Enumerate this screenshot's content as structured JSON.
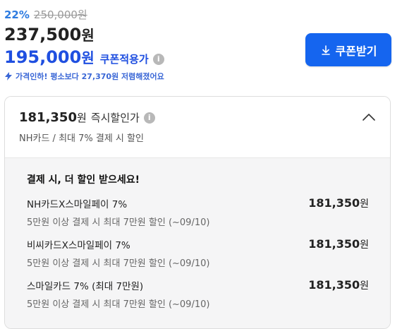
{
  "pricing": {
    "discount_rate": "22%",
    "original_price": "250,000원",
    "sale_price_number": "237,500",
    "sale_price_unit": "원",
    "coupon_price_number": "195,000",
    "coupon_price_unit": "원",
    "coupon_label": "쿠폰적용가",
    "price_drop_notice": "가격인하! 평소보다 27,370원 저렴해졌어요"
  },
  "coupon_button": {
    "label": "쿠폰받기"
  },
  "instant_discount": {
    "price_number": "181,350",
    "price_unit": "원",
    "label": "즉시할인가",
    "subtitle": "NH카드 / 최대 7% 결제 시 할인"
  },
  "offers_panel": {
    "title": "결제 시, 더 할인 받으세요!",
    "items": [
      {
        "name": "NH카드X스마일페이 7%",
        "desc": "5만원 이상 결제 시 최대 7만원 할인 (~09/10)",
        "price_number": "181,350",
        "price_unit": "원"
      },
      {
        "name": "비씨카드X스마일페이 7%",
        "desc": "5만원 이상 결제 시 최대 7만원 할인 (~09/10)",
        "price_number": "181,350",
        "price_unit": "원"
      },
      {
        "name": "스마일카드 7% (최대 7만원)",
        "desc": "5만원 이상 결제 시 최대 7만원 할인 (~09/10)",
        "price_number": "181,350",
        "price_unit": "원"
      }
    ]
  },
  "icons": {
    "info": "info-icon",
    "bolt": "bolt-icon",
    "download": "download-icon",
    "chevron": "chevron-up-icon"
  },
  "colors": {
    "accent_blue": "#1565ef",
    "coupon_blue": "#1f4fe0",
    "discount_blue": "#2d7be0"
  }
}
